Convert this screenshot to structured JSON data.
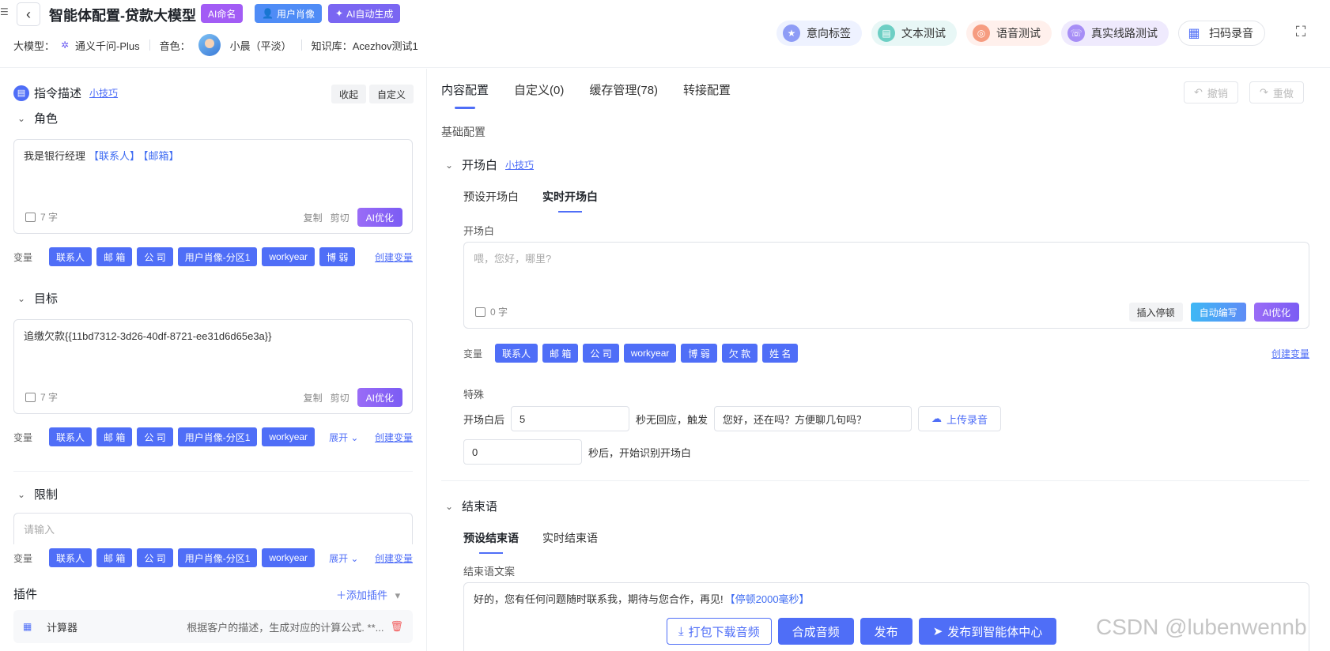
{
  "header": {
    "menu_glyph": "☰",
    "back_glyph": "‹",
    "title": "智能体配置-贷款大模型",
    "tags": {
      "ai_name": "AI命名",
      "persona": "用户肖像",
      "ai_gen": "AI自动生成"
    },
    "meta": {
      "model_label": "大模型：",
      "model_value": "通义千问-Plus",
      "voice_label": "音色：",
      "voice_value": "小晨（平淡）",
      "kb_label": "知识库：",
      "kb_value": "Acezhov测试1"
    },
    "tests": {
      "intent": "意向标签",
      "text": "文本测试",
      "voice": "语音测试",
      "line": "真实线路测试",
      "scan": "扫码录音"
    }
  },
  "left": {
    "instruction": {
      "title": "指令描述",
      "tip": "小技巧",
      "collapse": "收起",
      "custom": "自定义"
    },
    "role": {
      "title": "角色",
      "text": "我是银行经理",
      "vars": [
        "【联系人】",
        "【邮箱】"
      ],
      "count": "7 字",
      "copy": "复制",
      "cut": "剪切",
      "ai": "AI优化"
    },
    "role_vars": {
      "label": "变量",
      "chips": [
        "联系人",
        "邮 箱",
        "公 司",
        "用户肖像-分区1",
        "workyear",
        "博 弱"
      ],
      "create": "创建变量"
    },
    "goal": {
      "title": "目标",
      "text": "追缴欠款{{11bd7312-3d26-40df-8721-ee31d6d65e3a}}",
      "count": "7 字",
      "copy": "复制",
      "cut": "剪切",
      "ai": "AI优化"
    },
    "goal_vars": {
      "label": "变量",
      "chips": [
        "联系人",
        "邮 箱",
        "公 司",
        "用户肖像-分区1",
        "workyear"
      ],
      "expand": "展开",
      "create": "创建变量"
    },
    "limit": {
      "title": "限制",
      "placeholder": "请输入"
    },
    "limit_vars": {
      "label": "变量",
      "chips": [
        "联系人",
        "邮 箱",
        "公 司",
        "用户肖像-分区1",
        "workyear"
      ],
      "expand": "展开",
      "create": "创建变量"
    },
    "plugin": {
      "title": "插件",
      "add": "添加插件",
      "name": "计算器",
      "desc": "根据客户的描述，生成对应的计算公式. **..."
    }
  },
  "right": {
    "tabs": [
      "内容配置",
      "自定义(0)",
      "缓存管理(78)",
      "转接配置"
    ],
    "undo": "撤销",
    "redo": "重做",
    "basic": "基础配置",
    "opening": {
      "title": "开场白",
      "tip": "小技巧",
      "tab_preset": "预设开场白",
      "tab_realtime": "实时开场白",
      "field_label": "开场白",
      "placeholder": "喂，您好，哪里?",
      "count": "0 字",
      "insert_pause": "插入停顿",
      "auto_write": "自动编写",
      "ai": "AI优化",
      "var_label": "变量",
      "chips": [
        "联系人",
        "邮 箱",
        "公 司",
        "workyear",
        "博 弱",
        "欠 款",
        "姓 名"
      ],
      "create": "创建变量"
    },
    "special": {
      "label": "特殊",
      "after": "开场白后",
      "seconds_value": "5",
      "no_response": "秒无回应，触发",
      "trigger_text": "您好，还在吗？方便聊几句吗？",
      "upload": "上传录音",
      "recognize_value": "0",
      "recognize_text": "秒后，开始识别开场白"
    },
    "closing": {
      "title": "结束语",
      "tab_preset": "预设结束语",
      "tab_realtime": "实时结束语",
      "field_label": "结束语文案",
      "text": "好的，您有任何问题随时联系我，期待与您合作，再见!",
      "pause": "【停顿2000毫秒】"
    }
  },
  "bottom": {
    "download": "打包下载音频",
    "synth": "合成音频",
    "publish": "发布",
    "publish_center": "发布到智能体中心"
  },
  "watermark": "CSDN @lubenwennb"
}
